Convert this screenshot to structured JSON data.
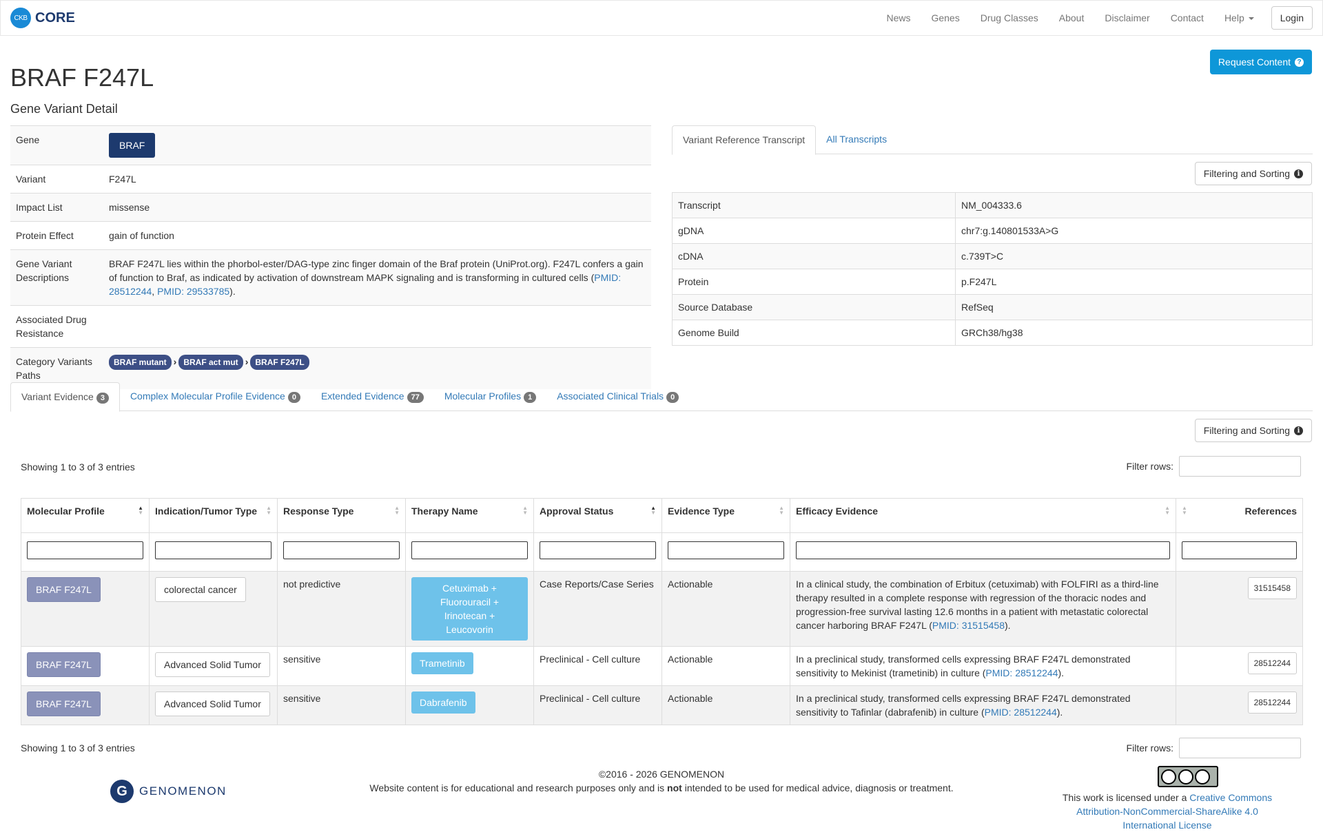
{
  "nav": {
    "logo_badge": "CKB",
    "logo_text": "CORE",
    "links": [
      "News",
      "Genes",
      "Drug Classes",
      "About",
      "Disclaimer",
      "Contact",
      "Help"
    ],
    "login": "Login"
  },
  "header": {
    "request_btn": "Request Content",
    "title": "BRAF F247L",
    "subtitle": "Gene Variant Detail"
  },
  "detail": {
    "gene_label": "Gene",
    "gene_value": "BRAF",
    "variant_label": "Variant",
    "variant_value": "F247L",
    "impact_label": "Impact List",
    "impact_value": "missense",
    "protein_label": "Protein Effect",
    "protein_value": "gain of function",
    "desc_label": "Gene Variant Descriptions",
    "desc_text": "BRAF F247L lies within the phorbol-ester/DAG-type zinc finger domain of the Braf protein (UniProt.org). F247L confers a gain of function to Braf, as indicated by activation of downstream MAPK signaling and is transforming in cultured cells (",
    "desc_link1": "PMID: 28512244",
    "desc_sep": ", ",
    "desc_link2": "PMID: 29533785",
    "desc_end": ").",
    "resistance_label": "Associated Drug Resistance",
    "category_label": "Category Variants Paths",
    "category_paths": [
      "BRAF mutant",
      "BRAF act mut",
      "BRAF F247L"
    ]
  },
  "transcript": {
    "tab_active": "Variant Reference Transcript",
    "tab_other": "All Transcripts",
    "filter_btn": "Filtering and Sorting",
    "rows": [
      {
        "k": "Transcript",
        "v": "NM_004333.6"
      },
      {
        "k": "gDNA",
        "v": "chr7:g.140801533A>G"
      },
      {
        "k": "cDNA",
        "v": "c.739T>C"
      },
      {
        "k": "Protein",
        "v": "p.F247L"
      },
      {
        "k": "Source Database",
        "v": "RefSeq"
      },
      {
        "k": "Genome Build",
        "v": "GRCh38/hg38"
      }
    ]
  },
  "evidence_tabs": [
    {
      "label": "Variant Evidence",
      "count": "3"
    },
    {
      "label": "Complex Molecular Profile Evidence",
      "count": "0"
    },
    {
      "label": "Extended Evidence",
      "count": "77"
    },
    {
      "label": "Molecular Profiles",
      "count": "1"
    },
    {
      "label": "Associated Clinical Trials",
      "count": "0"
    }
  ],
  "evidence": {
    "filter_btn": "Filtering and Sorting",
    "showing": "Showing 1 to 3 of 3 entries",
    "filter_rows": "Filter rows:",
    "columns": [
      "Molecular Profile",
      "Indication/Tumor Type",
      "Response Type",
      "Therapy Name",
      "Approval Status",
      "Evidence Type",
      "Efficacy Evidence",
      "References"
    ],
    "rows": [
      {
        "profile": "BRAF F247L",
        "indication": "colorectal cancer",
        "response": "not predictive",
        "therapy": "Cetuximab + Fluorouracil + Irinotecan + Leucovorin",
        "approval": "Case Reports/Case Series",
        "evidence_type": "Actionable",
        "efficacy": "In a clinical study, the combination of Erbitux (cetuximab) with FOLFIRI as a third-line therapy resulted in a complete response with regression of the thoracic nodes and progression-free survival lasting 12.6 months in a patient with metastatic colorectal cancer harboring BRAF F247L (",
        "efficacy_link": "PMID: 31515458",
        "efficacy_end": ").",
        "reference": "31515458"
      },
      {
        "profile": "BRAF F247L",
        "indication": "Advanced Solid Tumor",
        "response": "sensitive",
        "therapy": "Trametinib",
        "approval": "Preclinical - Cell culture",
        "evidence_type": "Actionable",
        "efficacy": "In a preclinical study, transformed cells expressing BRAF F247L demonstrated sensitivity to Mekinist (trametinib) in culture (",
        "efficacy_link": "PMID: 28512244",
        "efficacy_end": ").",
        "reference": "28512244"
      },
      {
        "profile": "BRAF F247L",
        "indication": "Advanced Solid Tumor",
        "response": "sensitive",
        "therapy": "Dabrafenib",
        "approval": "Preclinical - Cell culture",
        "evidence_type": "Actionable",
        "efficacy": "In a preclinical study, transformed cells expressing BRAF F247L demonstrated sensitivity to Tafinlar (dabrafenib) in culture (",
        "efficacy_link": "PMID: 28512244",
        "efficacy_end": ").",
        "reference": "28512244"
      }
    ]
  },
  "footer": {
    "logo_letter": "G",
    "logo_text": "GENOMENON",
    "copyright": "©2016 - 2026 GENOMENON",
    "disclaimer_pre": "Website content is for educational and research purposes only and is ",
    "disclaimer_bold": "not",
    "disclaimer_post": " intended to be used for medical advice, diagnosis or treatment.",
    "license_pre": "This work is licensed under a ",
    "license_link": "Creative Commons Attribution-NonCommercial-ShareAlike 4.0 International License"
  }
}
